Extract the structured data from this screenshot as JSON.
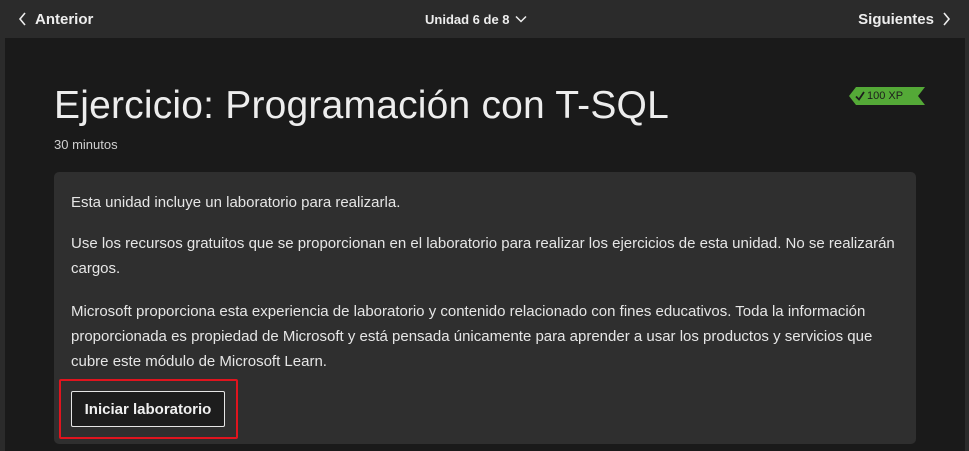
{
  "nav": {
    "prev_label": "Anterior",
    "unit_label": "Unidad 6 de 8",
    "next_label": "Siguientes"
  },
  "header": {
    "title": "Ejercicio: Programación con T-SQL",
    "duration": "30 minutos",
    "xp": "100 XP"
  },
  "lab": {
    "paragraphs": [
      "Esta unidad incluye un laboratorio para realizarla.",
      "Use los recursos gratuitos que se proporcionan en el laboratorio para realizar los ejercicios de esta unidad. No se realizarán cargos.",
      "Microsoft proporciona esta experiencia de laboratorio y contenido relacionado con fines educativos. Toda la información proporcionada es propiedad de Microsoft y está pensada únicamente para aprender a usar los productos y servicios que cubre este módulo de Microsoft Learn."
    ],
    "start_button": "Iniciar laboratorio"
  },
  "colors": {
    "background": "#1a1a1a",
    "topbar": "#2b2b2b",
    "card": "#2f2f2f",
    "xp_badge": "#54a937",
    "highlight": "#e0141e"
  },
  "icons": {
    "prev": "chevron-left-icon",
    "unit": "chevron-down-icon",
    "next": "chevron-right-icon",
    "xp": "checkmark-icon"
  }
}
